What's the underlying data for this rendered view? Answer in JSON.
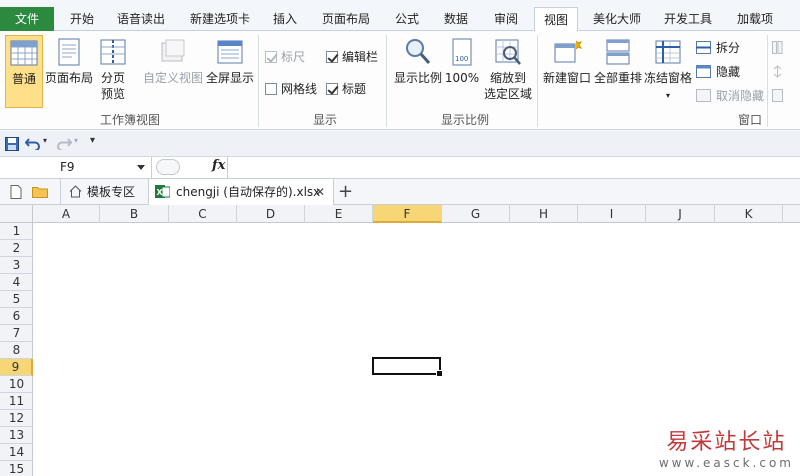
{
  "ribbon_tabs": [
    {
      "label": "文件"
    },
    {
      "label": "开始"
    },
    {
      "label": "语音读出"
    },
    {
      "label": "新建选项卡"
    },
    {
      "label": "插入"
    },
    {
      "label": "页面布局"
    },
    {
      "label": "公式"
    },
    {
      "label": "数据"
    },
    {
      "label": "审阅"
    },
    {
      "label": "视图"
    },
    {
      "label": "美化大师"
    },
    {
      "label": "开发工具"
    },
    {
      "label": "加载项"
    }
  ],
  "groups": {
    "workbook_views": {
      "label": "工作簿视图",
      "normal": "普通",
      "page_layout": "页面布局",
      "page_break_preview_1": "分页",
      "page_break_preview_2": "预览",
      "custom_views": "自定义视图",
      "full_screen": "全屏显示"
    },
    "show": {
      "label": "显示",
      "ruler": "标尺",
      "formula_bar": "编辑栏",
      "gridlines": "网格线",
      "headings": "标题"
    },
    "zoom": {
      "label": "显示比例",
      "zoom": "显示比例",
      "zoom_100": "100%",
      "zoom_selection_1": "缩放到",
      "zoom_selection_2": "选定区域"
    },
    "window": {
      "label": "窗口",
      "new_window": "新建窗口",
      "arrange_all": "全部重排",
      "freeze_panes": "冻结窗格",
      "split": "拆分",
      "hide": "隐藏",
      "unhide": "取消隐藏"
    }
  },
  "formula_bar": {
    "name_box": "F9",
    "fx": "fx"
  },
  "doc_tabs": {
    "template_zone": "模板专区",
    "file_name": "chengji (自动保存的).xlsx",
    "close": "✕",
    "add": "+"
  },
  "columns": [
    "A",
    "B",
    "C",
    "D",
    "E",
    "F",
    "G",
    "H",
    "I",
    "J",
    "K"
  ],
  "rows": [
    "1",
    "2",
    "3",
    "4",
    "5",
    "6",
    "7",
    "8",
    "9",
    "10",
    "11",
    "12",
    "13",
    "14",
    "15"
  ],
  "selection": {
    "column": "F",
    "row": "9"
  },
  "watermark": {
    "line1": "易采站长站",
    "line2": "www.easck.com"
  },
  "colors": {
    "file_tab": "#2b8a3e",
    "selected_header": "#f7d676"
  }
}
